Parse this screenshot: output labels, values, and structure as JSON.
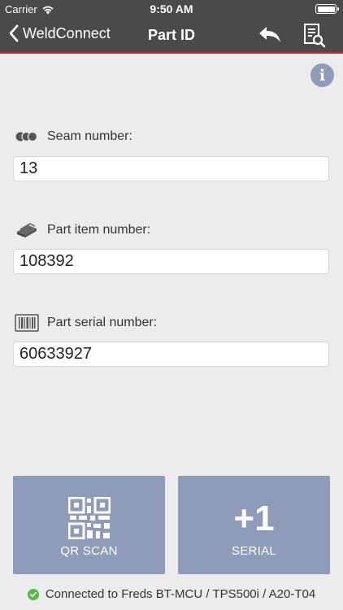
{
  "statusbar": {
    "carrier": "Carrier",
    "time": "9:50 AM"
  },
  "navbar": {
    "back_label": "WeldConnect",
    "title": "Part ID"
  },
  "fields": {
    "seam": {
      "label": "Seam number:",
      "value": "13"
    },
    "part_item": {
      "label": "Part item number:",
      "value": "108392"
    },
    "part_serial": {
      "label": "Part serial number:",
      "value": "60633927"
    }
  },
  "buttons": {
    "qr_scan": "QR SCAN",
    "serial_plus": "+1",
    "serial": "SERIAL",
    "info": "i"
  },
  "connection": {
    "text": "Connected to Freds BT-MCU / TPS500i / A20-T04"
  },
  "colors": {
    "accent": "#8e9cba",
    "navbar": "#4a4a4a",
    "divider": "#d8202f",
    "ok": "#58b847"
  }
}
